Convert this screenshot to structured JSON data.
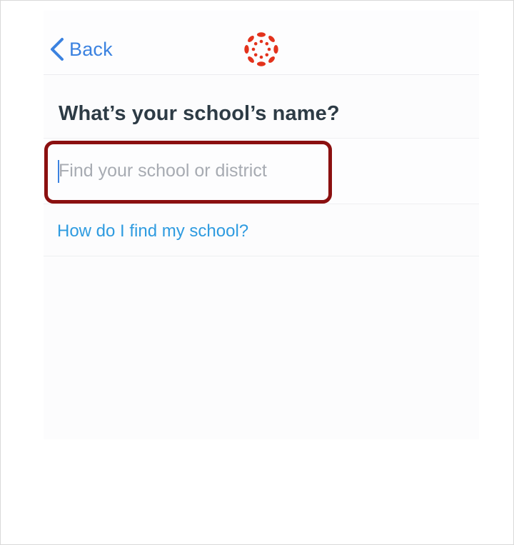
{
  "nav": {
    "back_label": "Back",
    "logo_icon": "canvas-logo-icon",
    "accent_color": "#3b82e0",
    "logo_color": "#e3321c"
  },
  "main": {
    "title": "What’s your school’s name?",
    "search": {
      "value": "",
      "placeholder": "Find your school or district"
    },
    "help_link": "How do I find my school?",
    "link_color": "#2e9be0",
    "highlight_color": "#8b1010"
  }
}
